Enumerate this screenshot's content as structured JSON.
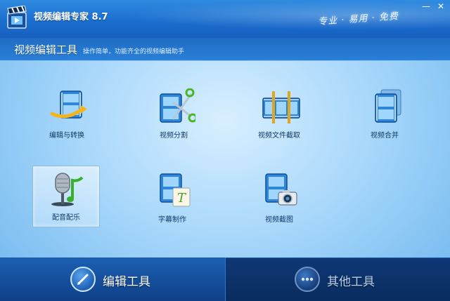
{
  "window": {
    "title": "视频编辑专家 8.7",
    "slogan": "专业 · 易用 · 免费",
    "minimize_glyph": "—",
    "close_glyph": "✕"
  },
  "section": {
    "title": "视频编辑工具",
    "subtitle": "操作简单，功能齐全的视频编辑助手"
  },
  "tools": [
    {
      "label": "编辑与转换",
      "icon": "film-arrow-icon"
    },
    {
      "label": "视频分割",
      "icon": "film-scissors-icon"
    },
    {
      "label": "视频文件截取",
      "icon": "film-crop-icon"
    },
    {
      "label": "视频合并",
      "icon": "film-stack-icon"
    },
    {
      "label": "配音配乐",
      "icon": "microphone-music-icon",
      "selected": true
    },
    {
      "label": "字幕制作",
      "icon": "film-text-icon"
    },
    {
      "label": "视频截图",
      "icon": "film-camera-icon"
    }
  ],
  "bottom_tabs": [
    {
      "label": "编辑工具",
      "icon": "pencil-icon",
      "active": true
    },
    {
      "label": "其他工具",
      "icon": "more-dots-icon",
      "active": false
    }
  ],
  "colors": {
    "title_bar": "#1a6ccd",
    "content_bg": "#a9d8fb",
    "bottom_bar": "#0a2c5e",
    "label_text": "#123a66"
  }
}
